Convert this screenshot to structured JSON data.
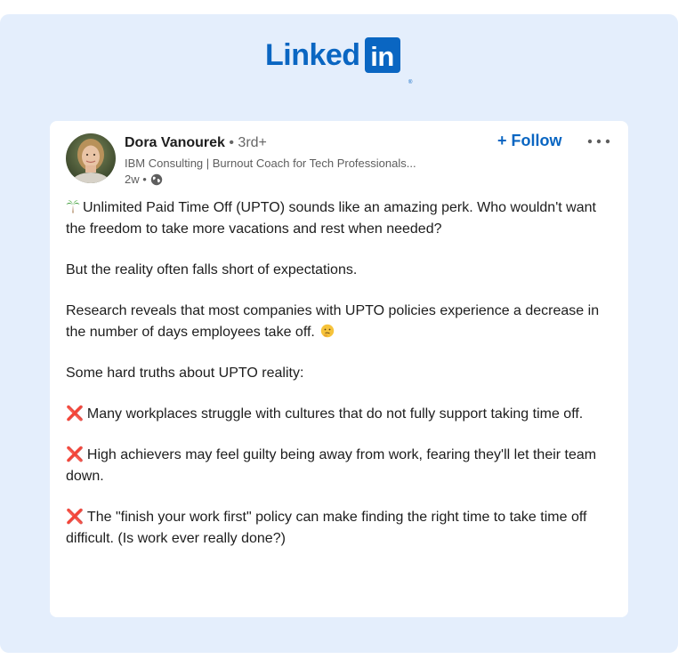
{
  "brand": {
    "logo_word": "Linked",
    "logo_box": "in",
    "logo_reg": "®",
    "color": "#0a66c2"
  },
  "post": {
    "author": {
      "name": "Dora Vanourek",
      "degree": " • 3rd+",
      "headline": "IBM Consulting | Burnout Coach for Tech Professionals...",
      "time": "2w • ",
      "visibility_icon": "globe-icon",
      "avatar_icon": "avatar"
    },
    "follow_label": "+ Follow",
    "more_icon": "more-options-icon",
    "paragraphs": {
      "p1": "Unlimited Paid Time Off (UPTO) sounds like an amazing perk. Who wouldn't want the freedom to take more vacations and rest when needed?",
      "p2": "But the reality often falls short of expectations.",
      "p3": "Research reveals that most companies with UPTO policies experience a decrease in the number of days employees take off.",
      "p4": "Some hard truths about UPTO reality:",
      "p5": "Many workplaces struggle with cultures that do not fully support taking time off.",
      "p6": "High achievers may feel guilty being away from work, fearing they'll let their team down.",
      "p7": "The \"finish your work first\" policy can make finding the right time to take time off difficult. (Is work ever really done?)"
    },
    "emoji": {
      "palm": "palm-tree-icon",
      "think": "thinking-face-icon",
      "cross": "❌"
    }
  },
  "colors": {
    "background": "#e4eefc",
    "card": "#ffffff",
    "accent": "#0a66c2",
    "cross": "#e0262b"
  }
}
